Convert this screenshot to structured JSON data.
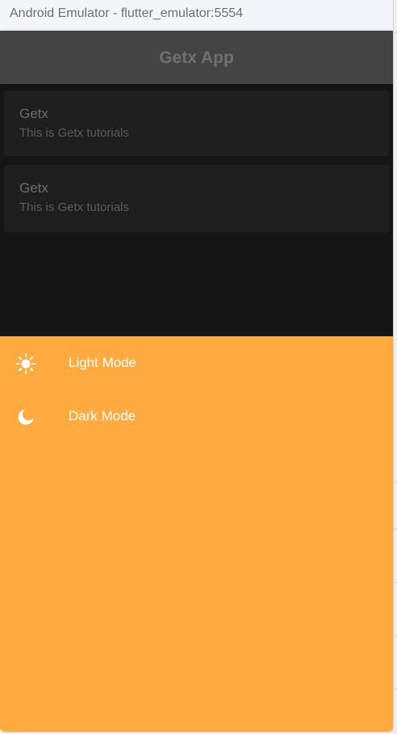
{
  "window": {
    "title": "Android Emulator - flutter_emulator:5554"
  },
  "appbar": {
    "title": "Getx App"
  },
  "list": {
    "items": [
      {
        "title": "Getx",
        "subtitle": "This is Getx tutorials"
      },
      {
        "title": "Getx",
        "subtitle": "This is Getx tutorials"
      }
    ]
  },
  "sheet": {
    "items": [
      {
        "icon": "sun-icon",
        "label": "Light Mode"
      },
      {
        "icon": "moon-icon",
        "label": "Dark Mode"
      }
    ]
  },
  "colors": {
    "appbar": "#444444",
    "background": "#151515",
    "card": "#1e1e1e",
    "sheet": "#ffab40",
    "sheet_text": "#ffffff"
  }
}
